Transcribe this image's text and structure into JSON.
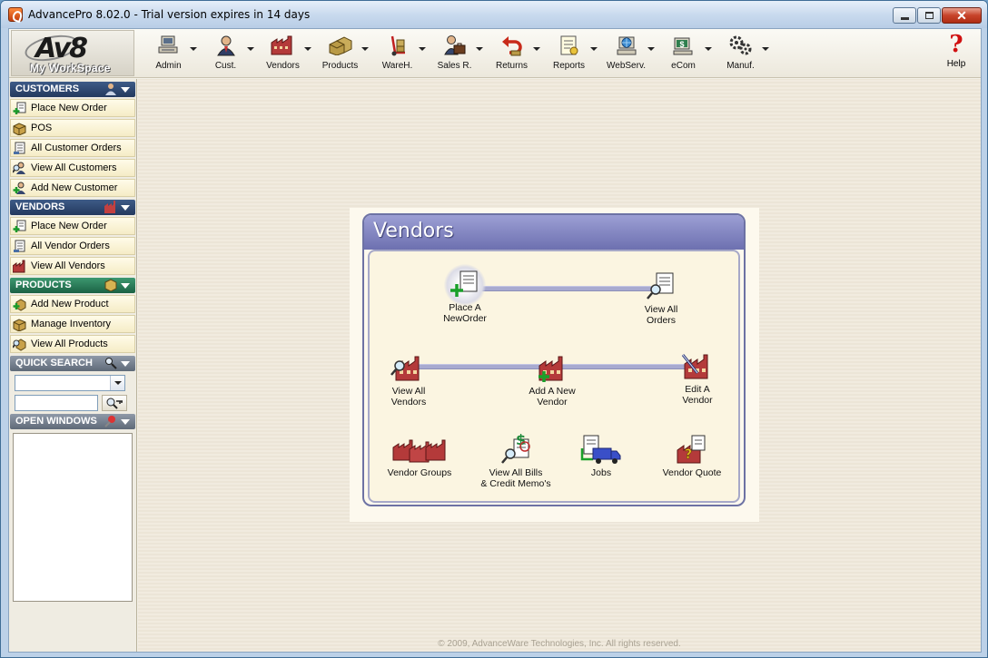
{
  "window": {
    "title": "AdvancePro 8.02.0 - Trial version expires in 14 days"
  },
  "logo": {
    "brand": "Av8",
    "subtitle": "My WorkSpace"
  },
  "toolbar": {
    "items": [
      {
        "label": "Admin",
        "icon": "computer-icon"
      },
      {
        "label": "Cust.",
        "icon": "customer-icon"
      },
      {
        "label": "Vendors",
        "icon": "factory-icon"
      },
      {
        "label": "Products",
        "icon": "boxes-icon"
      },
      {
        "label": "WareH.",
        "icon": "handtruck-icon"
      },
      {
        "label": "Sales R.",
        "icon": "briefcase-icon"
      },
      {
        "label": "Returns",
        "icon": "return-arrow-icon"
      },
      {
        "label": "Reports",
        "icon": "report-icon"
      },
      {
        "label": "WebServ.",
        "icon": "globe-computer-icon"
      },
      {
        "label": "eCom",
        "icon": "ecom-dollar-icon"
      },
      {
        "label": "Manuf.",
        "icon": "gears-icon"
      }
    ],
    "help_label": "Help"
  },
  "sidebar": {
    "customers": {
      "header": "CUSTOMERS",
      "items": [
        "Place New Order",
        "POS",
        "All Customer Orders",
        "View All Customers",
        "Add New Customer"
      ]
    },
    "vendors": {
      "header": "VENDORS",
      "items": [
        "Place New Order",
        "All Vendor Orders",
        "View All Vendors"
      ]
    },
    "products": {
      "header": "PRODUCTS",
      "items": [
        "Add New Product",
        "Manage Inventory",
        "View All Products"
      ]
    },
    "quick_search": {
      "header": "QUICK SEARCH",
      "select_value": "",
      "input_value": ""
    },
    "open_windows": {
      "header": "OPEN WINDOWS"
    }
  },
  "panel": {
    "title": "Vendors",
    "nodes": {
      "place_order": "Place A\nNewOrder",
      "view_orders": "View All\nOrders",
      "view_vendors": "View All\nVendors",
      "add_vendor": "Add A New\nVendor",
      "edit_vendor": "Edit A\nVendor",
      "vendor_groups": "Vendor Groups",
      "view_bills": "View All Bills\n& Credit Memo's",
      "jobs": "Jobs",
      "vendor_quote": "Vendor Quote"
    }
  },
  "footer": {
    "copyright": "© 2009, AdvanceWare Technologies, Inc. All rights reserved."
  }
}
